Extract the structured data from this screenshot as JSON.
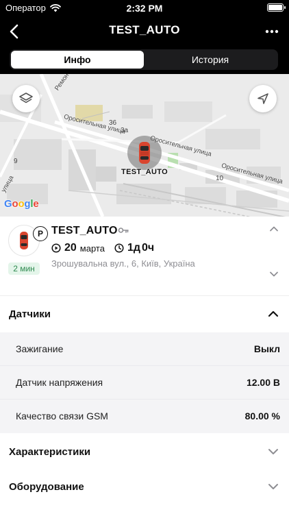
{
  "status_bar": {
    "carrier": "Оператор",
    "time": "2:32 PM"
  },
  "nav": {
    "title": "TEST_AUTO"
  },
  "tabs": [
    {
      "label": "Инфо",
      "active": true
    },
    {
      "label": "История",
      "active": false
    }
  ],
  "map": {
    "marker_label": "TEST_AUTO",
    "google_logo": "Google",
    "streets": {
      "remontnaya": "Ремонтная улица",
      "orositelnaya_left": "Оросительная улица",
      "orositelnaya_mid": "Оросительная улица",
      "orositelnaya_right": "Оросительная улица",
      "ulitsa_left": "улица"
    },
    "house_numbers": {
      "n36": "36",
      "n3a": "3а",
      "n9": "9",
      "n10": "10"
    }
  },
  "vehicle": {
    "name": "TEST_AUTO",
    "parking_badge": "P",
    "ago_badge": "2 мин",
    "date_day": "20",
    "date_month": "марта",
    "duration_days": "1д",
    "duration_hours": "0ч",
    "address": "Зрошувальна вул., 6, Київ, Україна"
  },
  "sections": {
    "sensors": {
      "title": "Датчики",
      "rows": [
        {
          "label": "Зажигание",
          "value": "Выкл"
        },
        {
          "label": "Датчик напряжения",
          "value": "12.00 В"
        },
        {
          "label": "Качество связи GSM",
          "value": "80.00 %"
        }
      ]
    },
    "characteristics": {
      "title": "Характеристики"
    },
    "equipment": {
      "title": "Оборудование"
    }
  },
  "colors": {
    "car_red": "#d9452f",
    "badge_green_bg": "#e4f5ea",
    "badge_green_text": "#2e8a4f",
    "segment_bg": "#1c1c1e"
  }
}
